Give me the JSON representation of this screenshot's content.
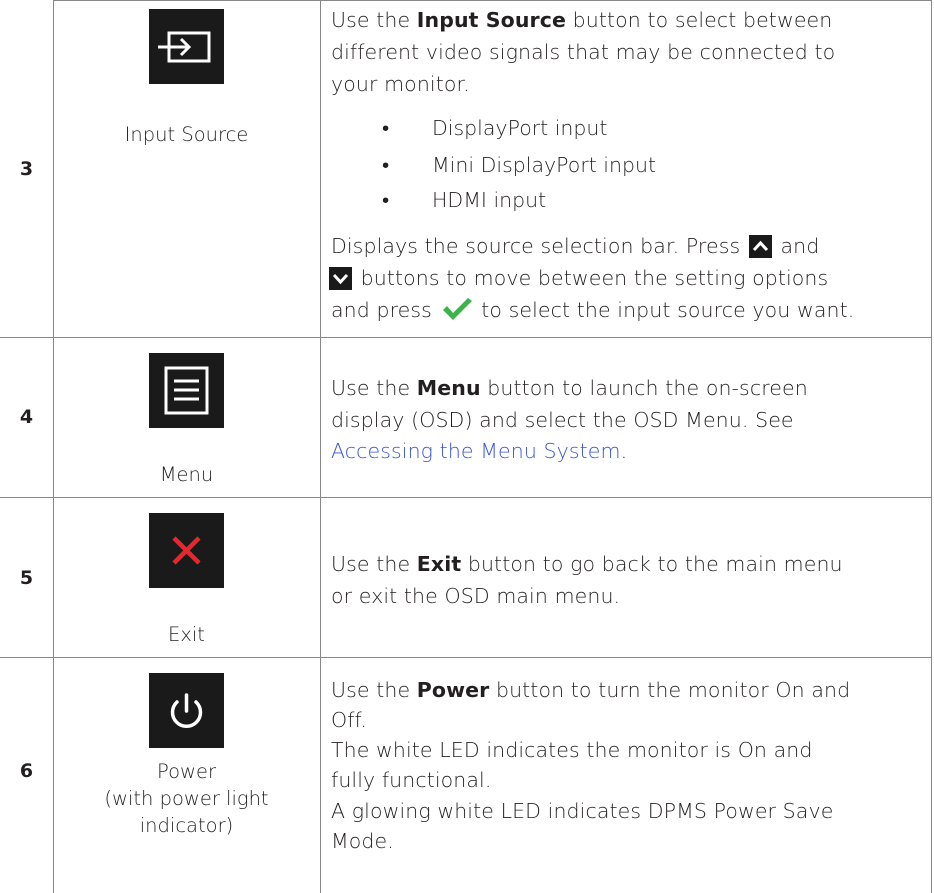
{
  "rows": [
    {
      "number": "3",
      "caption": "Input Source",
      "icon": "input-source-icon",
      "intro_prefix": "Use the ",
      "intro_bold": "Input Source",
      "intro_rest_1": " button to select between",
      "intro_line_2": "different video signals that may be connected to",
      "intro_line_3": "your monitor.",
      "bullets": [
        "DisplayPort input",
        "Mini DisplayPort input",
        "HDMI input"
      ],
      "line_a_1": "Displays the source selection bar. Press ",
      "line_a_2": " and",
      "line_b": " buttons to move between the setting options",
      "line_c_1": "and press ",
      "line_c_2": " to select the input source you want."
    },
    {
      "number": "4",
      "caption": "Menu",
      "icon": "menu-icon",
      "intro_prefix": "Use the ",
      "intro_bold": "Menu",
      "intro_rest_1": " button to launch the on-screen",
      "intro_line_2": "display (OSD) and select the OSD Menu. See",
      "link_text": "Accessing the Menu System",
      "link_suffix": "."
    },
    {
      "number": "5",
      "caption": "Exit",
      "icon": "exit-icon",
      "intro_prefix": "Use the ",
      "intro_bold": "Exit",
      "intro_rest_1": " button to go back to the main menu",
      "intro_line_2": "or exit the OSD main menu."
    },
    {
      "number": "6",
      "caption_1": "Power",
      "caption_2": "(with power light",
      "caption_3": "indicator)",
      "icon": "power-icon",
      "intro_prefix": "Use the ",
      "intro_bold": "Power",
      "intro_rest_1": " button to turn the monitor On and",
      "intro_line_2": "Off.",
      "line_3": "The white LED indicates the monitor is On and",
      "line_4": "fully functional.",
      "line_5": "A glowing white LED indicates DPMS Power Save",
      "line_6": "Mode."
    }
  ],
  "colors": {
    "text": "#231f20",
    "link": "#3a54d6",
    "icon_bg": "#1a1a1a",
    "exit_red": "#e8262d",
    "check_green": "#3cb449",
    "border": "#888888"
  }
}
